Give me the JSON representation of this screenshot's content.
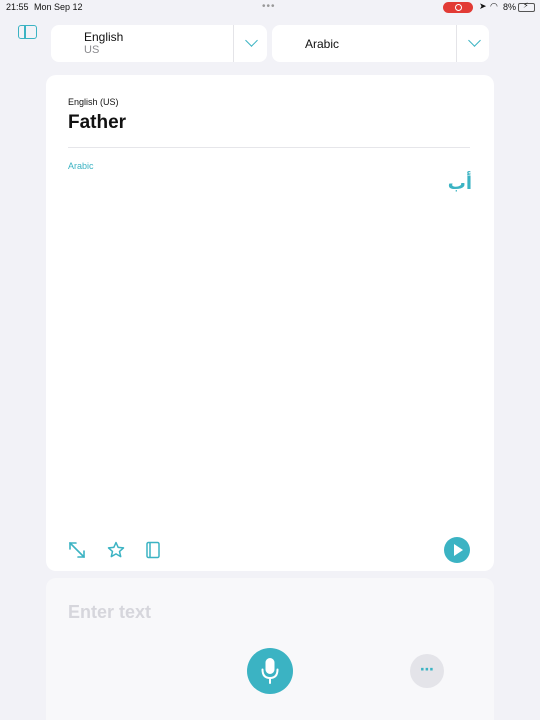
{
  "status_bar": {
    "time": "21:55",
    "date": "Mon Sep 12",
    "battery_percent": "8%"
  },
  "source_language": {
    "name": "English",
    "region": "US"
  },
  "target_language": {
    "name": "Arabic"
  },
  "translation": {
    "source_label": "English (US)",
    "source_text": "Father",
    "target_label": "Arabic",
    "target_text": "أب"
  },
  "input": {
    "placeholder": "Enter text"
  },
  "more_button": {
    "label": "⋯"
  },
  "colors": {
    "accent": "#3bb3c3",
    "background": "#f2f2f7",
    "recording": "#e23b35"
  },
  "icons": {
    "sidebar": "sidebar-icon",
    "expand": "expand-icon",
    "favorite": "star-icon",
    "dictionary": "book-icon",
    "play": "play-icon",
    "microphone": "microphone-icon"
  }
}
